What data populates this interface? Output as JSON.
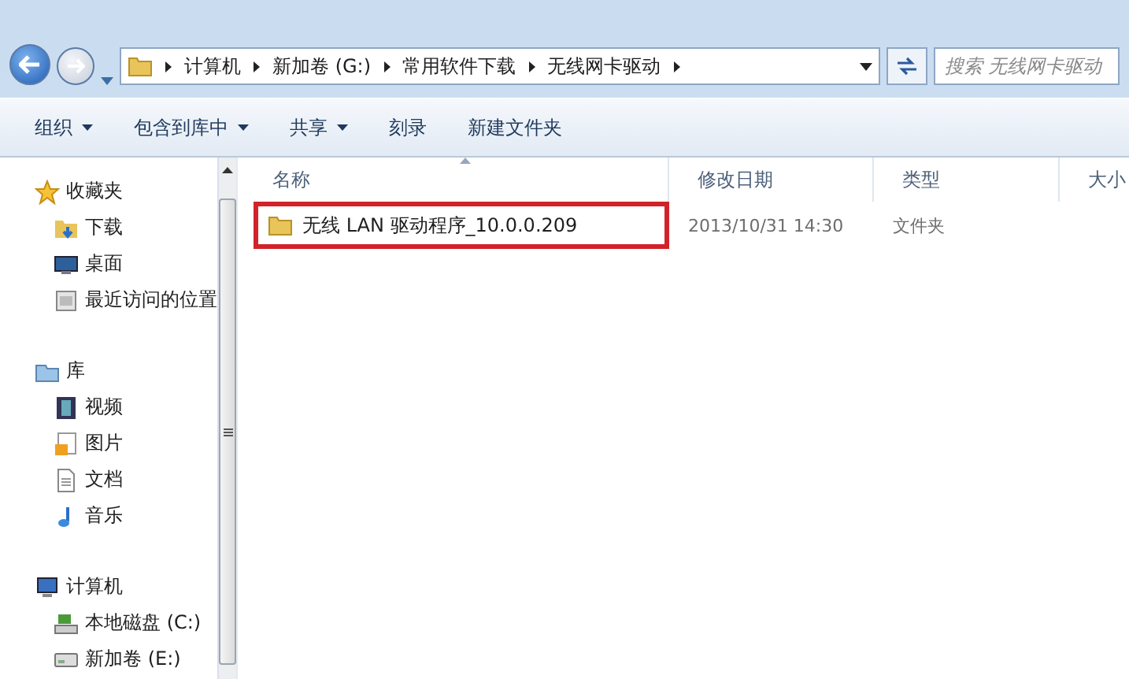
{
  "address_bar": {
    "crumbs": [
      "计算机",
      "新加卷 (G:)",
      "常用软件下载",
      "无线网卡驱动"
    ]
  },
  "search": {
    "placeholder": "搜索 无线网卡驱动"
  },
  "toolbar": [
    {
      "label": "组织",
      "dropdown": true
    },
    {
      "label": "包含到库中",
      "dropdown": true
    },
    {
      "label": "共享",
      "dropdown": true
    },
    {
      "label": "刻录",
      "dropdown": false
    },
    {
      "label": "新建文件夹",
      "dropdown": false
    }
  ],
  "navigation": [
    {
      "label": "收藏夹",
      "kind": "star",
      "children": [
        {
          "label": "下载",
          "kind": "download"
        },
        {
          "label": "桌面",
          "kind": "desktop"
        },
        {
          "label": "最近访问的位置",
          "kind": "recent"
        }
      ]
    },
    {
      "label": "库",
      "kind": "library",
      "children": [
        {
          "label": "视频",
          "kind": "video"
        },
        {
          "label": "图片",
          "kind": "picture"
        },
        {
          "label": "文档",
          "kind": "document"
        },
        {
          "label": "音乐",
          "kind": "music"
        }
      ]
    },
    {
      "label": "计算机",
      "kind": "computer",
      "children": [
        {
          "label": "本地磁盘 (C:)",
          "kind": "system-drive"
        },
        {
          "label": "新加卷 (E:)",
          "kind": "drive"
        }
      ]
    }
  ],
  "file_list": {
    "columns": [
      "名称",
      "修改日期",
      "类型",
      "大小"
    ],
    "rows": [
      {
        "name": "无线 LAN 驱动程序_10.0.0.209",
        "modified": "2013/10/31 14:30",
        "type": "文件夹",
        "highlighted": true
      }
    ]
  }
}
